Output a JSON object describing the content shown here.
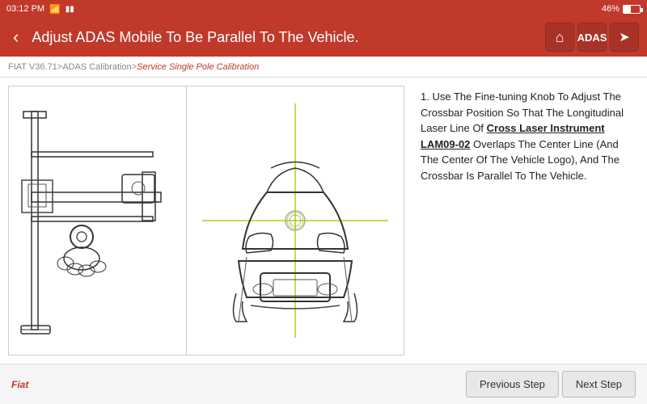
{
  "status": {
    "time": "03:12 PM",
    "battery_percent": "46%"
  },
  "header": {
    "title": "Adjust ADAS Mobile To Be Parallel To The Vehicle.",
    "back_label": "‹"
  },
  "breadcrumb": {
    "version": "FIAT V36.71",
    "separator1": " > ",
    "section": "ADAS Calibration",
    "separator2": " > ",
    "page": "Service Single Pole Calibration"
  },
  "instructions": {
    "number": "1.",
    "text1": " Use The Fine-tuning Knob To Adjust The Crossbar Position So That The Longitudinal Laser Line Of ",
    "highlight": "Cross Laser Instrument LAM09-02",
    "text2": " Overlaps The Center Line (And The Center Of The Vehicle Logo), And The Crossbar Is Parallel To The Vehicle."
  },
  "footer": {
    "brand": "Fiat",
    "prev_label": "Previous Step",
    "next_label": "Next Step"
  },
  "icons": {
    "home": "⌂",
    "adas": "▣",
    "share": "➤"
  }
}
